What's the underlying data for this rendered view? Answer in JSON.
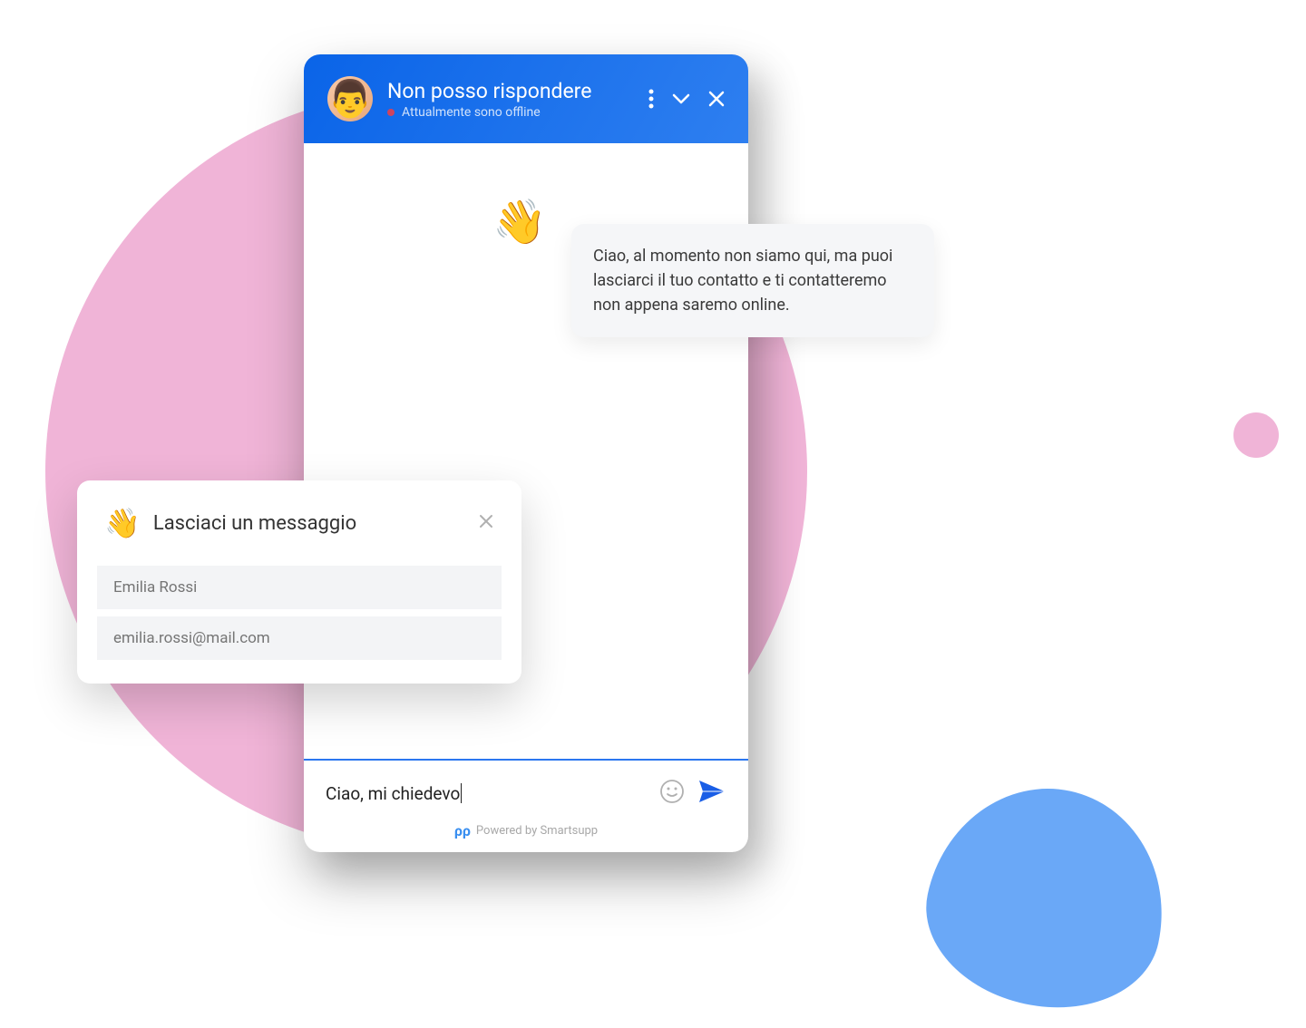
{
  "header": {
    "title": "Non posso rispondere",
    "status": "Attualmente sono offline"
  },
  "greeting": {
    "wave_emoji": "👋",
    "message": "Ciao, al momento non siamo qui, ma puoi lasciarci il tuo contatto e ti contatteremo non appena saremo online."
  },
  "contact_form": {
    "wave_emoji": "👋",
    "title": "Lasciaci un messaggio",
    "name_placeholder": "Emilia Rossi",
    "email_placeholder": "emilia.rossi@mail.com"
  },
  "input": {
    "text": "Ciao, mi chiedevo"
  },
  "footer": {
    "text": "Powered by Smartsupp",
    "icon": "ρρ"
  }
}
